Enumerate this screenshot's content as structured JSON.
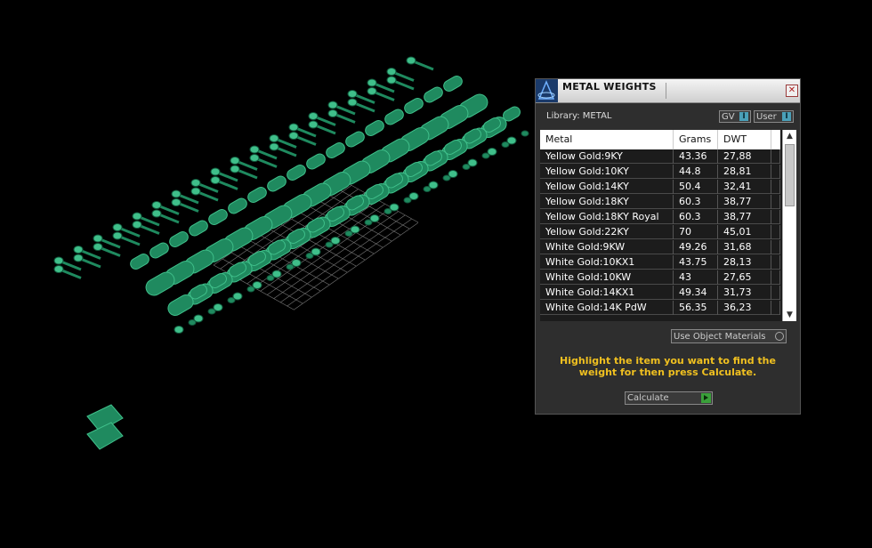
{
  "window": {
    "title": "METAL WEIGHTS",
    "close_icon": "close-icon",
    "logo_icon": "app-logo-icon"
  },
  "library": {
    "label": "Library: METAL",
    "toggles": [
      {
        "label": "GV",
        "indicator": "I"
      },
      {
        "label": "User",
        "indicator": "I"
      }
    ]
  },
  "table": {
    "columns": [
      "Metal",
      "Grams",
      "DWT"
    ],
    "rows": [
      [
        "Yellow Gold:9KY",
        "43.36",
        "27,88"
      ],
      [
        "Yellow Gold:10KY",
        "44.8",
        "28,81"
      ],
      [
        "Yellow Gold:14KY",
        "50.4",
        "32,41"
      ],
      [
        "Yellow Gold:18KY",
        "60.3",
        "38,77"
      ],
      [
        "Yellow Gold:18KY Royal",
        "60.3",
        "38,77"
      ],
      [
        "Yellow Gold:22KY",
        "70",
        "45,01"
      ],
      [
        "White Gold:9KW",
        "49.26",
        "31,68"
      ],
      [
        "White Gold:10KX1",
        "43.75",
        "28,13"
      ],
      [
        "White Gold:10KW",
        "43",
        "27,65"
      ],
      [
        "White Gold:14KX1",
        "49.34",
        "31,73"
      ],
      [
        "White Gold:14K PdW",
        "56.35",
        "36,23"
      ]
    ]
  },
  "use_object_materials": "Use Object Materials",
  "instruction": "Highlight the item you want to find the weight for then press Calculate.",
  "calculate_button": "Calculate",
  "colors": {
    "accent_text": "#f0c020",
    "model_green": "#1e8a60",
    "panel_bg": "#2e2e2e"
  }
}
